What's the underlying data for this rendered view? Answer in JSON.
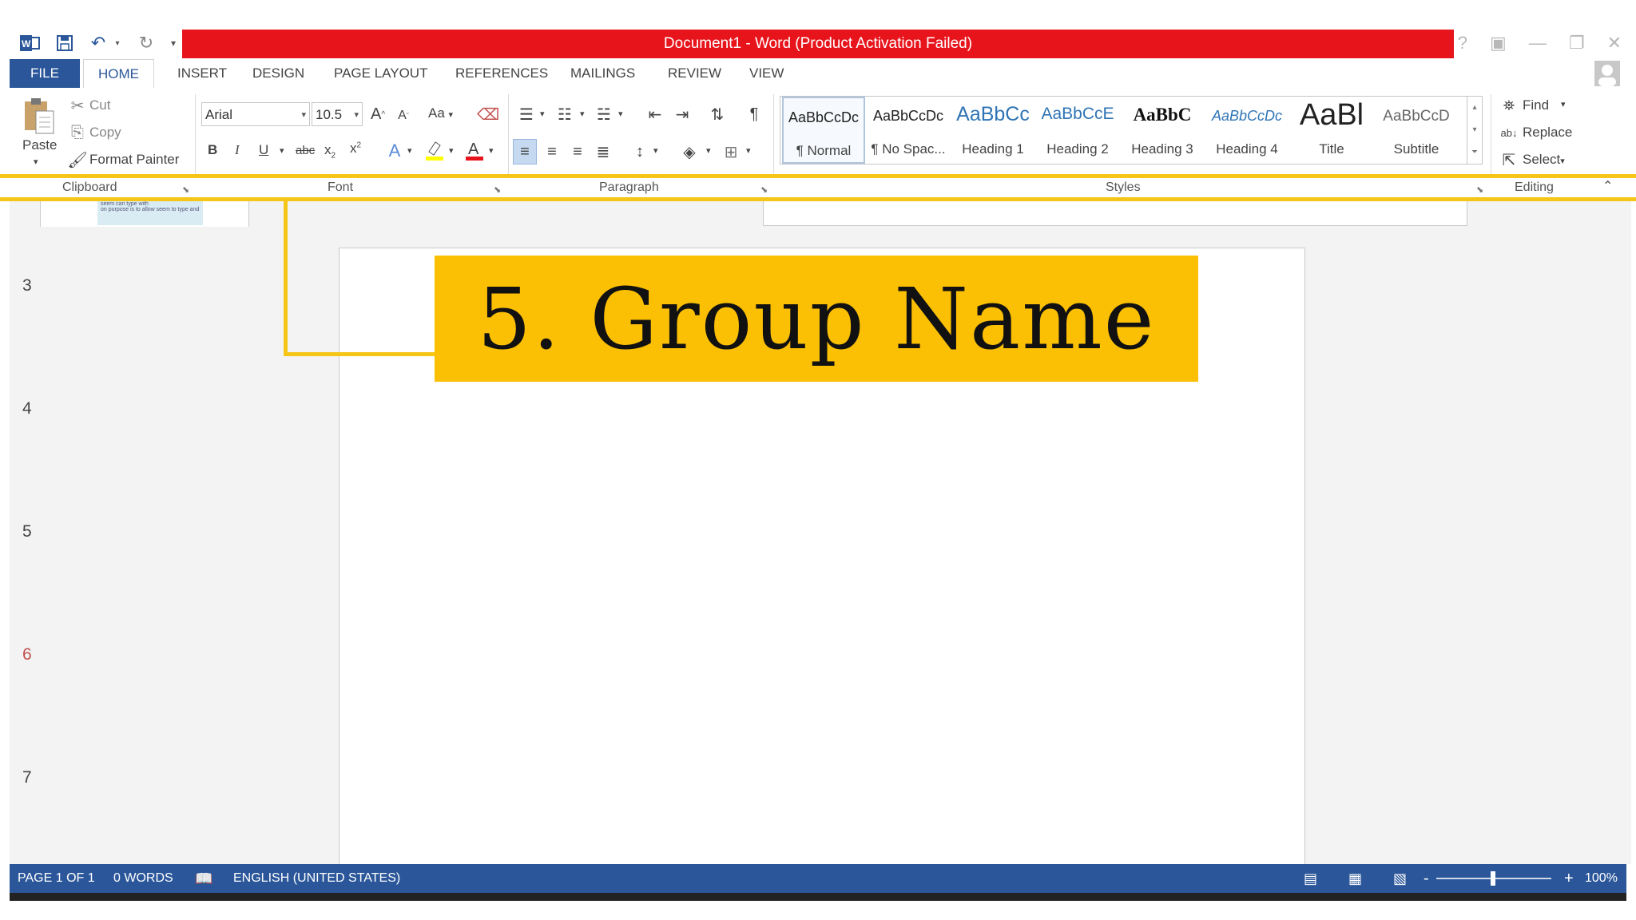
{
  "window": {
    "title": "Document1 -  Word (Product Activation Failed)",
    "help": "?"
  },
  "tabs": [
    {
      "label": "FILE"
    },
    {
      "label": "HOME"
    },
    {
      "label": "INSERT"
    },
    {
      "label": "DESIGN"
    },
    {
      "label": "PAGE LAYOUT"
    },
    {
      "label": "REFERENCES"
    },
    {
      "label": "MAILINGS"
    },
    {
      "label": "REVIEW"
    },
    {
      "label": "VIEW"
    }
  ],
  "clipboard": {
    "paste": "Paste",
    "cut": "Cut",
    "copy": "Copy",
    "format_painter": "Format Painter",
    "group": "Clipboard"
  },
  "font": {
    "name": "Arial",
    "size": "10.5",
    "change_case": "Aa",
    "bold": "B",
    "italic": "I",
    "underline": "U",
    "strike": "abc",
    "font_color": "A",
    "group": "Font"
  },
  "paragraph": {
    "group": "Paragraph",
    "pilcrow": "¶"
  },
  "styles": {
    "group": "Styles",
    "items": [
      {
        "preview": "AaBbCcDc",
        "name": "¶ Normal"
      },
      {
        "preview": "AaBbCcDc",
        "name": "¶ No Spac..."
      },
      {
        "preview": "AaBbCc",
        "name": "Heading 1"
      },
      {
        "preview": "AaBbCcE",
        "name": "Heading 2"
      },
      {
        "preview": "AaBbC",
        "name": "Heading 3"
      },
      {
        "preview": "AaBbCcDc",
        "name": "Heading 4"
      },
      {
        "preview": "AaBl",
        "name": "Title"
      },
      {
        "preview": "AaBbCcD",
        "name": "Subtitle"
      }
    ]
  },
  "editing": {
    "group": "Editing",
    "find": "Find",
    "replace": "Replace",
    "select": "Select"
  },
  "ruler": {
    "lines": [
      "3",
      "4",
      "5",
      "6",
      "7"
    ]
  },
  "thumbnail": {
    "line1": "seem can type with",
    "line2": "on purpose is to allow seem to type and"
  },
  "callout": {
    "text": "5. Group Name"
  },
  "status": {
    "page": "PAGE 1 OF 1",
    "words": "0 WORDS",
    "language": "ENGLISH (UNITED STATES)",
    "zoom": "100%",
    "zoom_minus": "-",
    "zoom_plus": "+"
  },
  "colors": {
    "title_bar": "#e8141c",
    "word_blue": "#2b579a",
    "highlight": "#f5c518",
    "callout_bg": "#fbbf04",
    "line_six": "#c0504d"
  }
}
